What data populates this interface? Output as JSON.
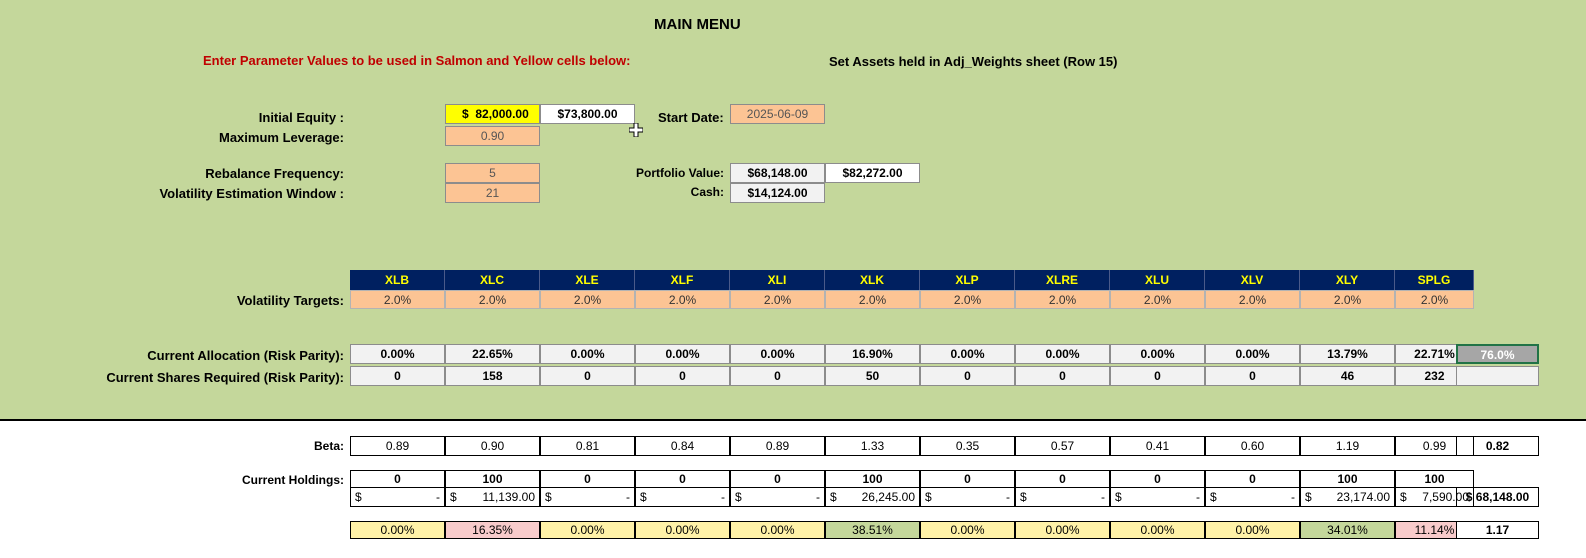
{
  "title": "MAIN MENU",
  "instructions": "Enter Parameter Values to be used in Salmon and Yellow cells below:",
  "assets_note": "Set Assets held in Adj_Weights sheet (Row 15)",
  "params": {
    "initial_equity_label": "Initial Equity :",
    "initial_equity_currency": "$",
    "initial_equity_value": "82,000.00",
    "initial_equity_derived": "$73,800.00",
    "max_leverage_label": "Maximum Leverage:",
    "max_leverage_value": "0.90",
    "rebalance_label": "Rebalance Frequency:",
    "rebalance_value": "5",
    "vol_window_label": "Volatility Estimation Window :",
    "vol_window_value": "21",
    "start_date_label": "Start Date:",
    "start_date_value": "2025-06-09",
    "portfolio_value_label": "Portfolio Value:",
    "portfolio_value": "$68,148.00",
    "portfolio_value_2": "$82,272.00",
    "cash_label": "Cash:",
    "cash_value": "$14,124.00"
  },
  "tickers": [
    "XLB",
    "XLC",
    "XLE",
    "XLF",
    "XLI",
    "XLK",
    "XLP",
    "XLRE",
    "XLU",
    "XLV",
    "XLY",
    "SPLG"
  ],
  "vol_targets_label": "Volatility Targets:",
  "vol_targets": [
    "2.0%",
    "2.0%",
    "2.0%",
    "2.0%",
    "2.0%",
    "2.0%",
    "2.0%",
    "2.0%",
    "2.0%",
    "2.0%",
    "2.0%",
    "2.0%"
  ],
  "alloc_label": "Current Allocation (Risk Parity):",
  "alloc": [
    "0.00%",
    "22.65%",
    "0.00%",
    "0.00%",
    "0.00%",
    "16.90%",
    "0.00%",
    "0.00%",
    "0.00%",
    "0.00%",
    "13.79%",
    "22.71%"
  ],
  "alloc_total": "76.0%",
  "shares_label": "Current Shares Required (Risk Parity):",
  "shares": [
    "0",
    "158",
    "0",
    "0",
    "0",
    "50",
    "0",
    "0",
    "0",
    "0",
    "46",
    "232"
  ],
  "beta_label": "Beta:",
  "beta": [
    "0.89",
    "0.90",
    "0.81",
    "0.84",
    "0.89",
    "1.33",
    "0.35",
    "0.57",
    "0.41",
    "0.60",
    "1.19",
    "0.99"
  ],
  "beta_total": "0.82",
  "holdings_label": "Current Holdings:",
  "holdings": [
    "0",
    "100",
    "0",
    "0",
    "0",
    "100",
    "0",
    "0",
    "0",
    "0",
    "100",
    "100"
  ],
  "holdings_value": [
    {
      "cur": "$",
      "amt": "-"
    },
    {
      "cur": "$",
      "amt": "11,139.00"
    },
    {
      "cur": "$",
      "amt": "-"
    },
    {
      "cur": "$",
      "amt": "-"
    },
    {
      "cur": "$",
      "amt": "-"
    },
    {
      "cur": "$",
      "amt": "26,245.00"
    },
    {
      "cur": "$",
      "amt": "-"
    },
    {
      "cur": "$",
      "amt": "-"
    },
    {
      "cur": "$",
      "amt": "-"
    },
    {
      "cur": "$",
      "amt": "-"
    },
    {
      "cur": "$",
      "amt": "23,174.00"
    },
    {
      "cur": "$",
      "amt": "7,590.00"
    }
  ],
  "holdings_total": "$ 68,148.00",
  "weights": [
    "0.00%",
    "16.35%",
    "0.00%",
    "0.00%",
    "0.00%",
    "38.51%",
    "0.00%",
    "0.00%",
    "0.00%",
    "0.00%",
    "34.01%",
    "11.14%"
  ],
  "weights_total": "1.17",
  "colors": {
    "green_bg": "#c4d79b",
    "salmon": "#fcc494",
    "yellow": "#ffff00",
    "header_navy": "#002060",
    "header_text": "#ffff00",
    "instruction_red": "#c00000",
    "weight_yellow": "#fff2a8",
    "weight_pink": "#f8cbcb",
    "weight_green": "#c4d79b"
  }
}
